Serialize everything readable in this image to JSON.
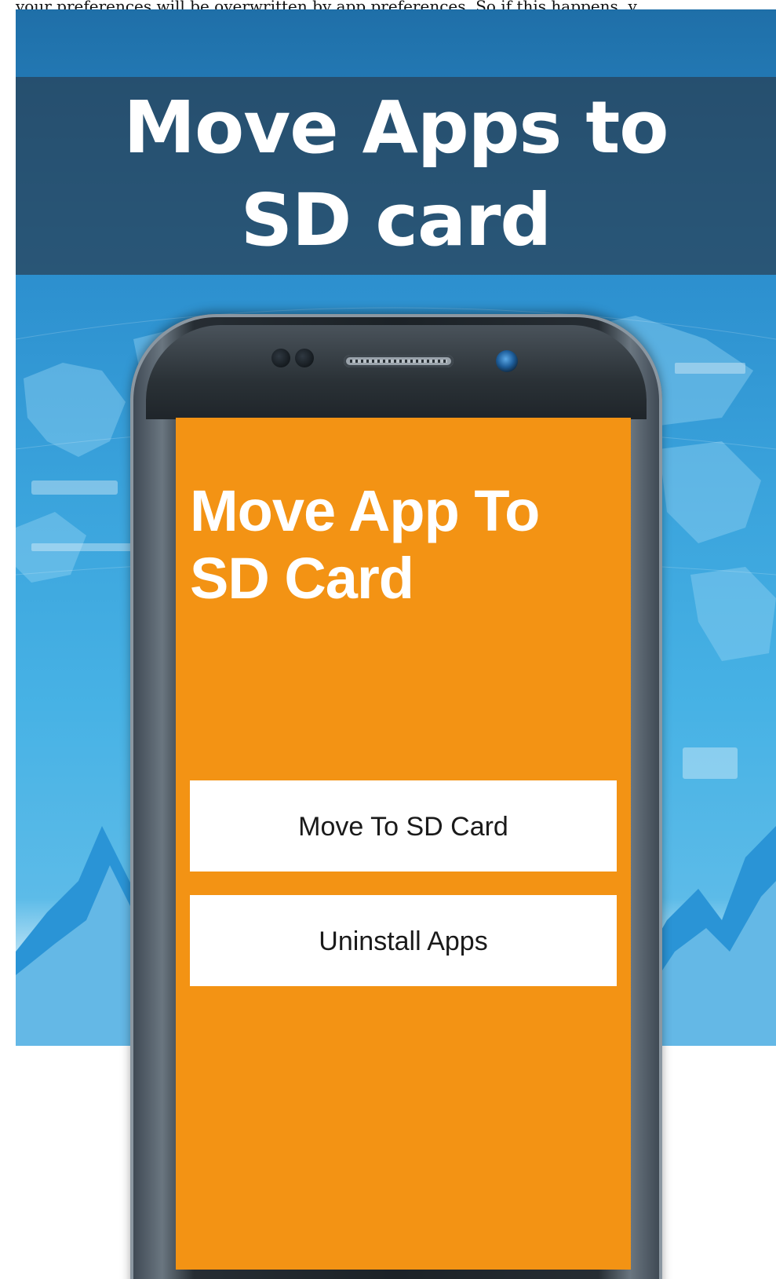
{
  "caption": {
    "text": "your preferences will be overwritten by app preferences. So if this happens, y"
  },
  "promo": {
    "title_line1": "Move Apps to",
    "title_line2": "SD card"
  },
  "app": {
    "title": "Move App To SD Card",
    "buttons": [
      {
        "label": "Move To SD Card"
      },
      {
        "label": "Uninstall Apps"
      }
    ]
  },
  "colors": {
    "screen_bg": "#f39314",
    "button_bg": "#ffffff",
    "title_band": "#284054",
    "sky_top": "#1f6fa8",
    "sky_bottom": "#5cbbe8"
  }
}
